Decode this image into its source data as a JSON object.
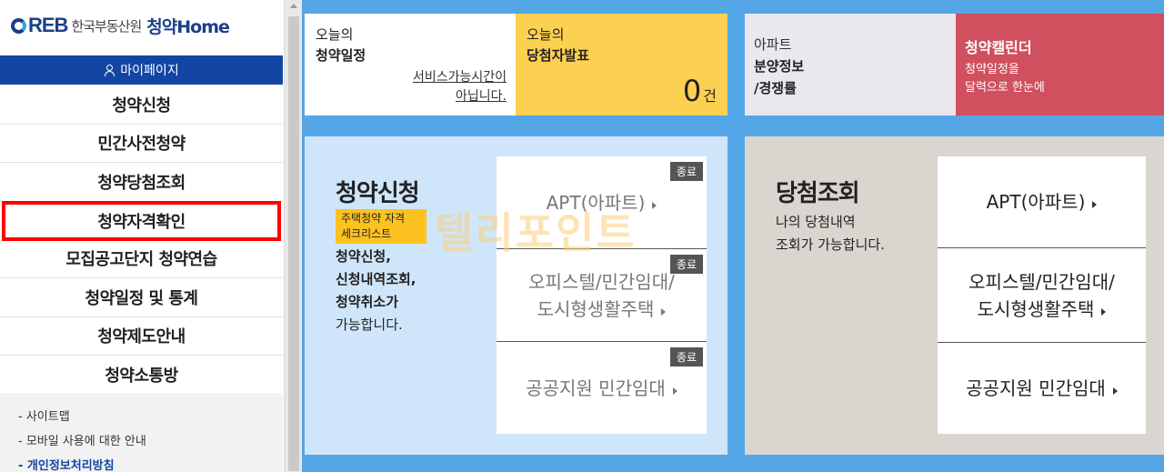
{
  "logo": {
    "rb": "REB",
    "agency": "한국부동산원",
    "brand_main": "청약",
    "brand_home": "Home"
  },
  "sidebar": {
    "mypage": "마이페이지",
    "items": [
      {
        "label": "청약신청"
      },
      {
        "label": "민간사전청약"
      },
      {
        "label": "청약당첨조회"
      },
      {
        "label": "청약자격확인",
        "highlighted": true
      },
      {
        "label": "모집공고단지 청약연습"
      },
      {
        "label": "청약일정 및 통계"
      },
      {
        "label": "청약제도안내"
      },
      {
        "label": "청약소통방"
      }
    ],
    "links": [
      "- 사이트맵",
      "- 모바일 사용에 대한 안내",
      "- 개인정보처리방침"
    ]
  },
  "top": {
    "schedule": {
      "l1": "오늘의",
      "l2": "청약일정",
      "service_line1": "서비스가능시간이",
      "service_line2": "아닙니다."
    },
    "winners": {
      "l1": "오늘의",
      "l2": "당첨자발표",
      "count": "0",
      "unit": "건"
    },
    "apt": {
      "l1": "아파트",
      "l2": "분양정보",
      "l3": "/경쟁률"
    },
    "calendar": {
      "title": "청약캘린더",
      "s1": "청약일정을",
      "s2": "달력으로 한눈에"
    }
  },
  "apply_card": {
    "title": "청약신청",
    "tag_line1": "주택청약 자격",
    "tag_line2": "세크리스트",
    "desc1": "청약신청,",
    "desc2": "신청내역조회,",
    "desc3": "청약취소가",
    "desc4": "가능합니다.",
    "entries": [
      {
        "line1": "APT(아파트)",
        "line2": "",
        "badge": "종료"
      },
      {
        "line1": "오피스텔/민간임대/",
        "line2": "도시형생활주택",
        "badge": "종료"
      },
      {
        "line1": "공공지원 민간임대",
        "line2": "",
        "badge": "종료"
      }
    ]
  },
  "win_card": {
    "title": "당첨조회",
    "desc1": "나의 당첨내역",
    "desc2": "조회가 가능합니다.",
    "entries": [
      {
        "line1": "APT(아파트)",
        "line2": ""
      },
      {
        "line1": "오피스텔/민간임대/",
        "line2": "도시형생활주택"
      },
      {
        "line1": "공공지원 민간임대",
        "line2": ""
      }
    ]
  },
  "watermark": "텔리포인트"
}
